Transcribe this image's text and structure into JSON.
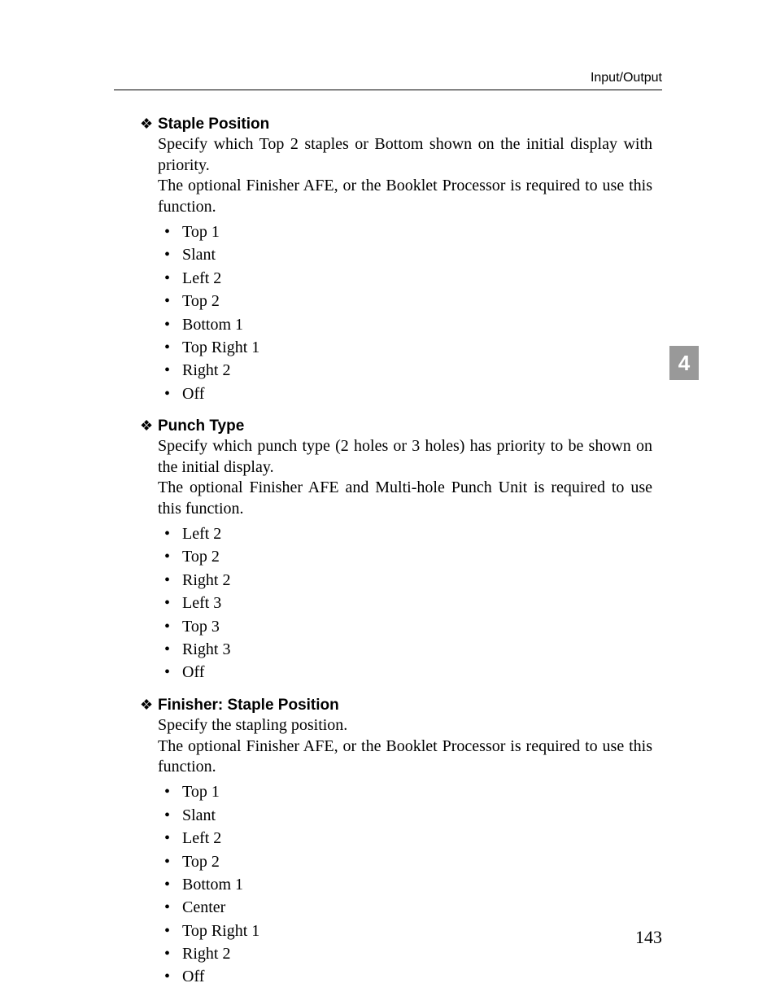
{
  "header": {
    "running_title": "Input/Output"
  },
  "chapter_tab": "4",
  "page_number": "143",
  "sections": [
    {
      "title": "Staple Position",
      "paragraphs": [
        "Specify which Top 2 staples or Bottom shown on the initial display with priority.",
        "The optional Finisher AFE, or the Booklet Processor is required to use this function."
      ],
      "items": [
        "Top 1",
        "Slant",
        "Left 2",
        "Top 2",
        "Bottom 1",
        "Top Right 1",
        "Right 2",
        "Off"
      ]
    },
    {
      "title": "Punch Type",
      "paragraphs": [
        "Specify which punch type (2 holes or 3 holes) has priority to be shown on the initial display.",
        "The optional Finisher AFE and Multi-hole Punch Unit is required to use this function."
      ],
      "items": [
        "Left 2",
        "Top 2",
        "Right 2",
        "Left 3",
        "Top 3",
        "Right 3",
        "Off"
      ]
    },
    {
      "title": "Finisher: Staple Position",
      "paragraphs": [
        "Specify the stapling position.",
        "The optional Finisher AFE, or the Booklet Processor is required to use this function."
      ],
      "items": [
        "Top 1",
        "Slant",
        "Left 2",
        "Top 2",
        "Bottom 1",
        "Center",
        "Top Right 1",
        "Right 2",
        "Off"
      ]
    }
  ]
}
